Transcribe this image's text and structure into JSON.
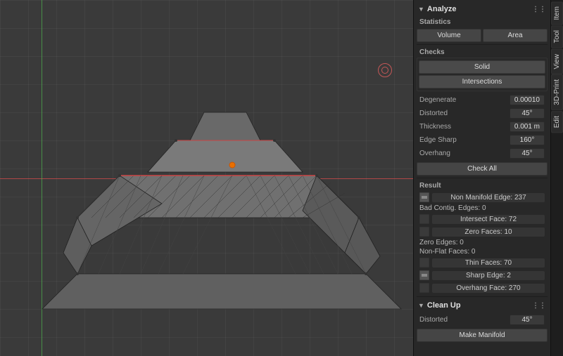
{
  "viewport": {
    "bg_color": "#3a3a3a"
  },
  "panel": {
    "analyze_header": "Analyze",
    "statistics_label": "Statistics",
    "volume_btn": "Volume",
    "area_btn": "Area",
    "checks_label": "Checks",
    "solid_btn": "Solid",
    "intersections_btn": "Intersections",
    "degenerate_label": "Degenerate",
    "degenerate_value": "0.00010",
    "distorted_label": "Distorted",
    "distorted_value": "45°",
    "thickness_label": "Thickness",
    "thickness_value": "0.001 m",
    "edge_sharp_label": "Edge Sharp",
    "edge_sharp_value": "160°",
    "overhang_label": "Overhang",
    "overhang_value": "45°",
    "check_all_btn": "Check All",
    "result_label": "Result",
    "non_manifold_edge_label": "Non Manifold Edge:",
    "non_manifold_edge_value": "237",
    "bad_contig_label": "Bad Contig. Edges:",
    "bad_contig_value": "0",
    "intersect_face_label": "Intersect Face:",
    "intersect_face_value": "72",
    "zero_faces_label": "Zero Faces:",
    "zero_faces_value": "10",
    "zero_edges_label": "Zero Edges:",
    "zero_edges_value": "0",
    "non_flat_label": "Non-Flat Faces:",
    "non_flat_value": "0",
    "thin_faces_label": "Thin Faces:",
    "thin_faces_value": "70",
    "sharp_edge_label": "Sharp Edge:",
    "sharp_edge_value": "2",
    "overhang_face_label": "Overhang Face:",
    "overhang_face_value": "270",
    "cleanup_header": "Clean Up",
    "cleanup_distorted_label": "Distorted",
    "cleanup_distorted_value": "45°",
    "make_manifold_btn": "Make Manifold"
  },
  "vertical_tabs": {
    "tool_label": "Tool",
    "view_label": "View",
    "print_label": "3D-Print",
    "edit_label": "Edit",
    "item_label": "Item"
  }
}
